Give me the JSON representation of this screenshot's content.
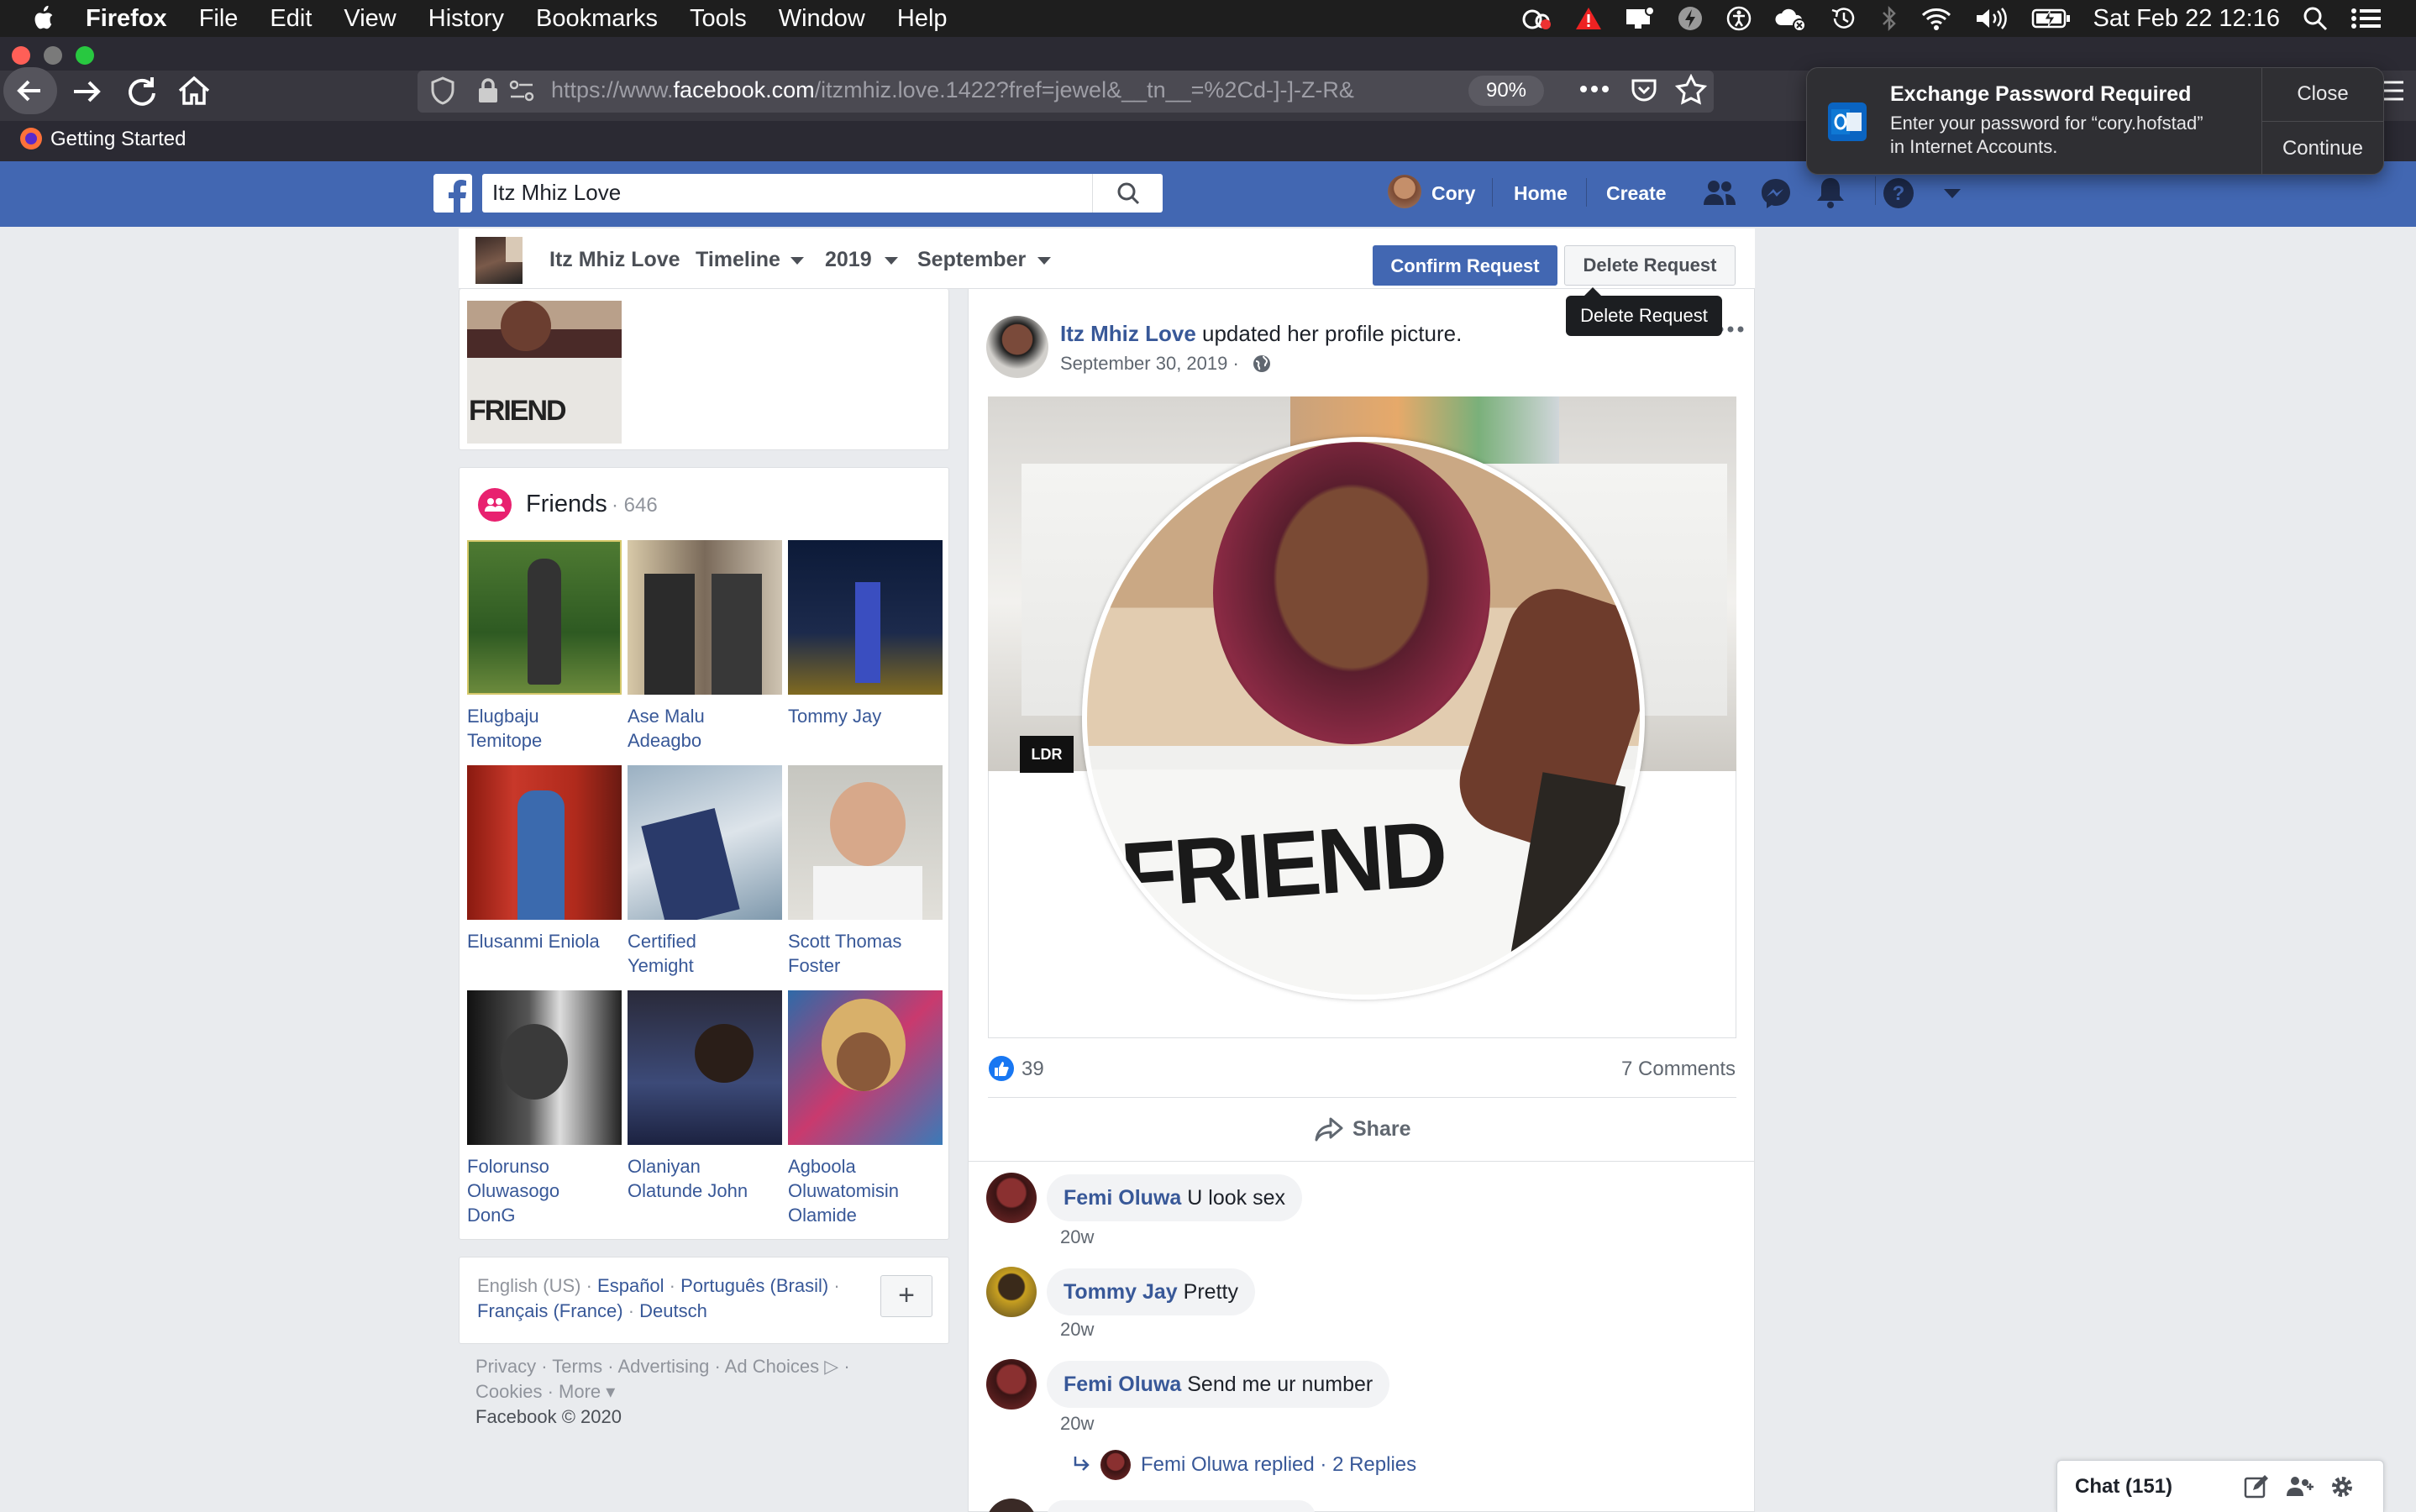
{
  "menubar": {
    "app": "Firefox",
    "items": [
      "File",
      "Edit",
      "View",
      "History",
      "Bookmarks",
      "Tools",
      "Window",
      "Help"
    ],
    "datetime": "Sat Feb 22  12:16"
  },
  "browser": {
    "url_prefix": "https://www.",
    "url_domain": "facebook.com",
    "url_path": "/itzmhiz.love.1422?fref=jewel&__tn__=%2Cd-]-]-Z-R&",
    "zoom": "90%",
    "bookmark": "Getting Started"
  },
  "notification": {
    "title": "Exchange Password Required",
    "line1": "Enter your password for “cory.hofstad”",
    "line2": "in Internet Accounts.",
    "close": "Close",
    "continue": "Continue"
  },
  "fbbar": {
    "search_value": "Itz Mhiz Love",
    "user": "Cory",
    "home": "Home",
    "create": "Create"
  },
  "profile_header": {
    "name": "Itz Mhiz Love",
    "timeline": "Timeline",
    "year": "2019",
    "month": "September",
    "confirm": "Confirm Request",
    "delete": "Delete Request",
    "tooltip": "Delete Request"
  },
  "friends": {
    "title": "Friends",
    "count": "· 646",
    "list": [
      {
        "line1": "Elugbaju",
        "line2": "Temitope",
        "line3": ""
      },
      {
        "line1": "Ase Malu",
        "line2": "Adeagbo",
        "line3": ""
      },
      {
        "line1": "Tommy Jay",
        "line2": "",
        "line3": ""
      },
      {
        "line1": "Elusanmi Eniola",
        "line2": "",
        "line3": ""
      },
      {
        "line1": "Certified",
        "line2": "Yemight",
        "line3": ""
      },
      {
        "line1": "Scott Thomas",
        "line2": "Foster",
        "line3": ""
      },
      {
        "line1": "Folorunso",
        "line2": "Oluwasogo",
        "line3": "DonG"
      },
      {
        "line1": "Olaniyan",
        "line2": "Olatunde John",
        "line3": ""
      },
      {
        "line1": "Agboola",
        "line2": "Oluwatomisin",
        "line3": "Olamide"
      }
    ]
  },
  "languages": {
    "current": "English (US) · ",
    "l1": "Español",
    "sep1": " · ",
    "l2": "Português (Brasil)",
    "sep2": " ·",
    "l3": "Français (France)",
    "sep3": " · ",
    "l4": "Deutsch",
    "add": "+"
  },
  "footer": {
    "line1": "Privacy · Terms · Advertising · Ad Choices ▷ ·",
    "line2": "Cookies · More ▾",
    "line3": "Facebook © 2020"
  },
  "post": {
    "author": "Itz Mhiz Love",
    "action": " updated her profile picture.",
    "date": "September 30, 2019 ·",
    "likes": "39",
    "comments_count": "7 Comments",
    "share": "Share",
    "cover_badge": "LDR",
    "shirt_text": "FRIEND"
  },
  "comments": [
    {
      "author": "Femi Oluwa",
      "text": " U look sex",
      "time": "20w"
    },
    {
      "author": "Tommy Jay",
      "text": " Pretty",
      "time": "20w"
    },
    {
      "author": "Femi Oluwa",
      "text": " Send me ur number",
      "time": "20w"
    }
  ],
  "replies": {
    "text": "Femi Oluwa replied · 2 Replies"
  },
  "chat": {
    "label": "Chat (151)"
  },
  "colors": {
    "fb_blue": "#4267b2",
    "link": "#385898",
    "notif_bg": "#2f2f33"
  }
}
